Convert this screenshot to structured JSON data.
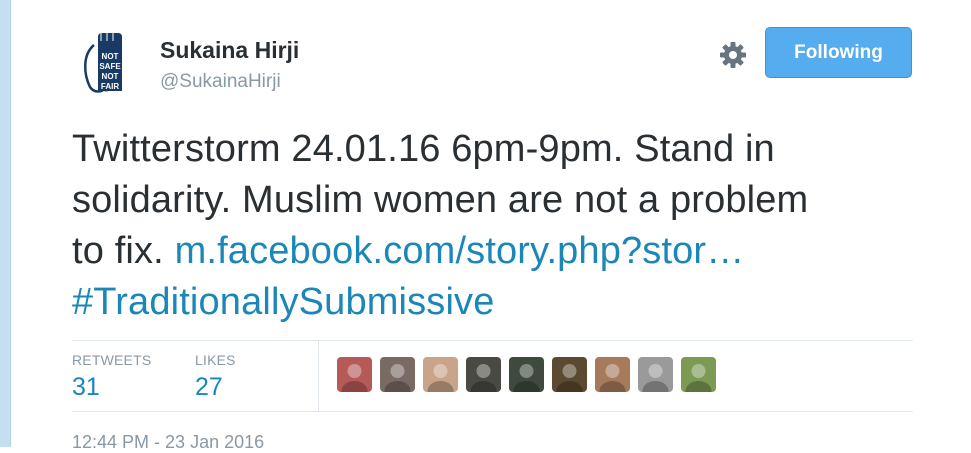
{
  "user": {
    "display_name": "Sukaina Hirji",
    "handle": "@SukainaHirji",
    "avatar_icon": "not-safe-not-fair-fist-icon",
    "avatar_text": "NOT SAFE NOT FAIR"
  },
  "actions": {
    "follow_label": "Following",
    "settings_icon": "gear-icon"
  },
  "tweet": {
    "line1": "Twitterstorm 24.01.16 6pm-9pm. Stand in",
    "line2": "solidarity. Muslim women are not a problem",
    "line3_prefix": "to fix. ",
    "link_text": "m.facebook.com/story.php?stor…",
    "hashtag": "#TraditionallySubmissive"
  },
  "stats": {
    "retweets_label": "RETWEETS",
    "retweets_value": "31",
    "likes_label": "LIKES",
    "likes_value": "27"
  },
  "likers": [
    {
      "name": "liker-avatar-1",
      "color": "#b65a58"
    },
    {
      "name": "liker-avatar-2",
      "color": "#7a6a64"
    },
    {
      "name": "liker-avatar-3",
      "color": "#c9a489"
    },
    {
      "name": "liker-avatar-4",
      "color": "#4a4a45"
    },
    {
      "name": "liker-avatar-5",
      "color": "#3d4a3d"
    },
    {
      "name": "liker-avatar-6",
      "color": "#5a4a30"
    },
    {
      "name": "liker-avatar-7",
      "color": "#a77a5c"
    },
    {
      "name": "liker-avatar-8",
      "color": "#9a9a9a"
    },
    {
      "name": "liker-avatar-9",
      "color": "#7d9a55"
    }
  ],
  "timestamp": "12:44 PM - 23 Jan 2016",
  "colors": {
    "accent": "#55acee",
    "link": "#1b87b8",
    "text": "#292f33",
    "muted": "#8899a6"
  }
}
